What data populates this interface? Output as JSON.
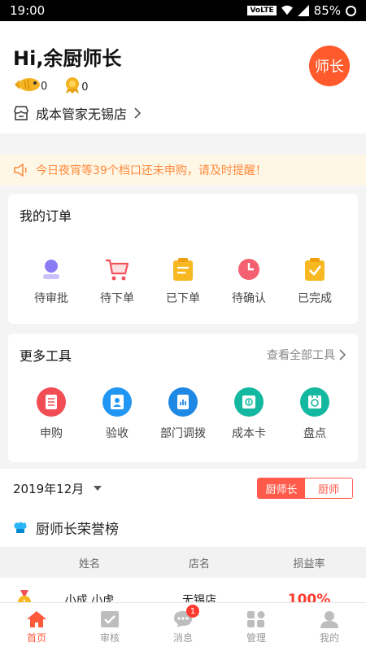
{
  "status": {
    "time": "19:00",
    "battery": "85%",
    "network_badge": "VoLTE"
  },
  "header": {
    "greeting": "Hi,余厨师长",
    "fish_count": "0",
    "medal_count": "0",
    "store_name": "成本管家无锡店",
    "avatar_text": "师长",
    "accent": "#ff5a2b"
  },
  "notice": {
    "text": "今日夜宵等39个档口还未申购，请及时提醒！"
  },
  "orders": {
    "title": "我的订单",
    "items": [
      {
        "label": "待审批",
        "icon": "person-icon"
      },
      {
        "label": "待下单",
        "icon": "cart-icon"
      },
      {
        "label": "已下单",
        "icon": "clipboard-icon"
      },
      {
        "label": "待确认",
        "icon": "clock-icon"
      },
      {
        "label": "已完成",
        "icon": "check-icon"
      }
    ]
  },
  "tools": {
    "title": "更多工具",
    "more": "查看全部工具",
    "items": [
      {
        "label": "申购",
        "icon": "doc-icon",
        "color": "#f24d55"
      },
      {
        "label": "验收",
        "icon": "badge-icon",
        "color": "#2196f3"
      },
      {
        "label": "部门调拨",
        "icon": "transfer-icon",
        "color": "#1e88e5"
      },
      {
        "label": "成本卡",
        "icon": "card-icon",
        "color": "#14b8a0"
      },
      {
        "label": "盘点",
        "icon": "inventory-icon",
        "color": "#14b8a0"
      }
    ]
  },
  "filter": {
    "date": "2019年12月",
    "seg_on": "厨师长",
    "seg_off": "厨师"
  },
  "honor": {
    "title": "厨师长荣誉榜",
    "columns": [
      "姓名",
      "店名",
      "损益率"
    ],
    "rows": [
      {
        "rank": "1",
        "name": "小成,小虎",
        "store": "无锡店",
        "rate": "100%"
      }
    ]
  },
  "tabbar": {
    "items": [
      {
        "label": "首页",
        "icon": "home-icon"
      },
      {
        "label": "审核",
        "icon": "checkbox-icon"
      },
      {
        "label": "消息",
        "icon": "chat-icon",
        "badge": "1"
      },
      {
        "label": "管理",
        "icon": "grid-icon"
      },
      {
        "label": "我的",
        "icon": "user-icon"
      }
    ]
  }
}
